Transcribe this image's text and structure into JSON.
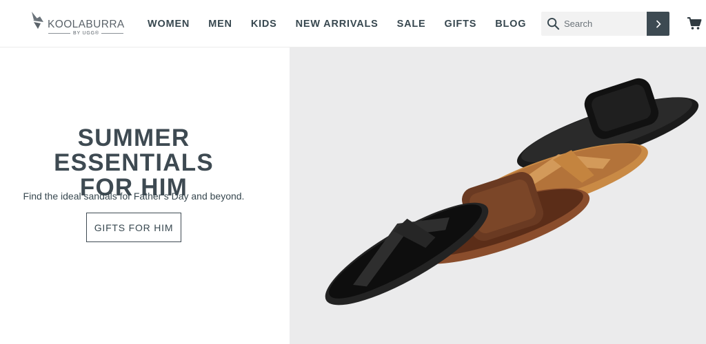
{
  "brand": {
    "name": "KOOLABURRA",
    "sub": "BY UGG®"
  },
  "nav": {
    "items": [
      {
        "label": "WOMEN"
      },
      {
        "label": "MEN"
      },
      {
        "label": "KIDS"
      },
      {
        "label": "NEW ARRIVALS"
      },
      {
        "label": "SALE"
      },
      {
        "label": "GIFTS"
      },
      {
        "label": "BLOG"
      }
    ]
  },
  "search": {
    "placeholder": "Search"
  },
  "hero": {
    "title_line1": "SUMMER ESSENTIALS",
    "title_line2": "FOR HIM",
    "subtitle": "Find the ideal sandals for Father’s Day and beyond.",
    "cta_label": "GIFTS FOR HIM",
    "image_alt": "Four men's sandals in black, brown and tan"
  },
  "colors": {
    "text": "#37474f",
    "heading": "#3e4a52",
    "search_button": "#3d4a52",
    "hero_bg": "#ebebec"
  },
  "icons": {
    "search": "search-icon",
    "arrow": "chevron-right-icon",
    "cart": "cart-icon"
  }
}
